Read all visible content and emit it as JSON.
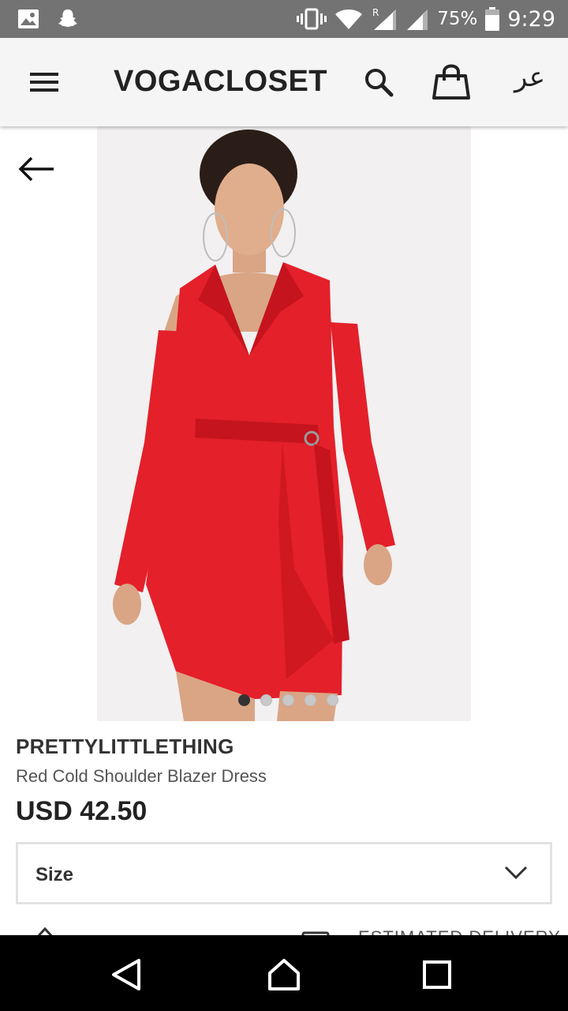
{
  "status_bar": {
    "battery_percent": "75%",
    "time": "9:29",
    "roaming_indicator": "R",
    "icons": [
      "gallery-icon",
      "snapchat-icon",
      "vibrate-icon",
      "wifi-icon",
      "signal-icon",
      "signal-icon",
      "battery-icon"
    ]
  },
  "app_bar": {
    "brand": "VOGACLOSET",
    "language_toggle": "عر",
    "icons": [
      "menu-icon",
      "search-icon",
      "shopping-bag-icon"
    ]
  },
  "gallery": {
    "image_count": 5,
    "active_index": 0,
    "background_color": "#f2f0f1",
    "dress_color": "#e4202a"
  },
  "product": {
    "brand": "PRETTYLITTLETHING",
    "name": "Red Cold Shoulder Blazer Dress",
    "price": "USD 42.50"
  },
  "size_select": {
    "label": "Size"
  },
  "below_fold": {
    "delivery_label": "ESTIMATED DELIVERY"
  },
  "nav_bar": {
    "icons": [
      "back-triangle-icon",
      "home-icon",
      "recents-square-icon"
    ]
  }
}
